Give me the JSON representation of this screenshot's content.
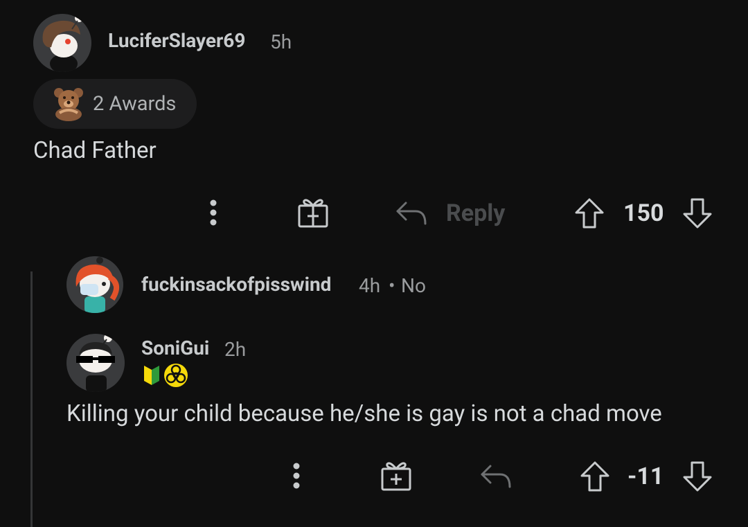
{
  "comment1": {
    "username": "LuciferSlayer69",
    "time": "5h",
    "awards_label": "2 Awards",
    "body": "Chad Father",
    "reply_label": "Reply",
    "score": "150",
    "avatar_icon": "snoo-avatar-curly-hair",
    "award_icon": "bear-award-icon"
  },
  "comment2": {
    "username": "fuckinsackofpisswind",
    "time": "4h",
    "separator": "•",
    "extra": "No",
    "avatar_icon": "snoo-avatar-orange-hair-mask"
  },
  "comment3": {
    "username": "SoniGui",
    "time": "2h",
    "flair_icons": [
      "beginner-badge-icon",
      "biohazard-icon"
    ],
    "body": "Killing your child because he/she is gay is not a chad move",
    "score": "-11",
    "avatar_icon": "snoo-avatar-sunglasses"
  },
  "colors": {
    "background": "#0f0f0f",
    "text": "#d7dadc",
    "muted": "#9a9c9e",
    "pill": "#1d1d1e",
    "thread_line": "#343536"
  }
}
